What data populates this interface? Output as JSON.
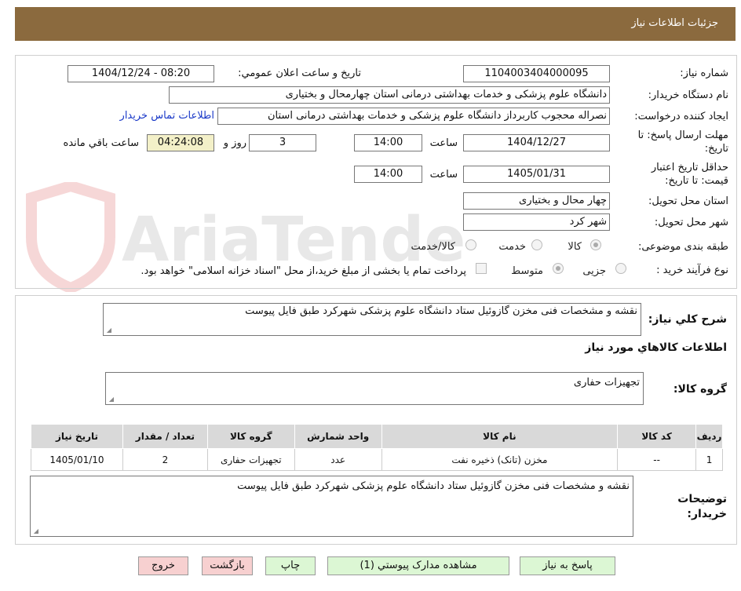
{
  "header": {
    "title": "جزئیات اطلاعات نیاز"
  },
  "watermark": {
    "text": "AriaTender.neT"
  },
  "form": {
    "need_number": {
      "label": "شماره نیاز:",
      "value": "1104003404000095"
    },
    "announce": {
      "label": "تاریخ و ساعت اعلان عمومي:",
      "value": "1404/12/24 - 08:20"
    },
    "buyer_org": {
      "label": "نام دستگاه خریدار:",
      "value": "دانشگاه علوم پزشکی و خدمات بهداشتی درمانی استان چهارمحال و بختیاری"
    },
    "requester": {
      "label": "ایجاد کننده درخواست:",
      "value": "نصراله محجوب کاربرداز دانشگاه علوم پزشکی و خدمات بهداشتی درمانی استان",
      "contact_link": "اطلاعات تماس خریدار"
    },
    "reply_deadline": {
      "label_line1": "مهلت ارسال پاسخ: تا",
      "label_line2": "تاریخ:",
      "date": "1404/12/27",
      "time_label": "ساعت",
      "time": "14:00",
      "days": "3",
      "days_label": "روز و",
      "remaining": "04:24:08",
      "remaining_label": "ساعت باقي مانده"
    },
    "price_validity": {
      "label_line1": "حداقل تاریخ اعتبار",
      "label_line2": "قیمت: تا تاریخ:",
      "date": "1405/01/31",
      "time_label": "ساعت",
      "time": "14:00"
    },
    "province": {
      "label": "استان محل تحویل:",
      "value": "چهار محال و بختیاری"
    },
    "city": {
      "label": "شهر محل تحویل:",
      "value": "شهر کرد"
    },
    "category": {
      "label": "طبقه بندی موضوعی:",
      "options": [
        "کالا",
        "خدمت",
        "کالا/خدمت"
      ],
      "selected": "کالا"
    },
    "process": {
      "label": "نوع فرآیند خرید :",
      "options": [
        "جزیی",
        "متوسط"
      ],
      "selected": "متوسط",
      "payment_note": "پرداخت تمام یا بخشی از مبلغ خرید،از محل \"اسناد خزانه اسلامی\" خواهد بود."
    }
  },
  "summary": {
    "label": "شرح كلي نياز:",
    "value": "نقشه و مشخصات فنی مخزن گازوئیل ستاد دانشگاه علوم پزشکی شهرکرد طبق فایل پیوست"
  },
  "goods_title": "اطلاعات کالاهاي مورد نياز",
  "goods_group": {
    "label": "گروه کالا:",
    "value": "تجهیزات حفاری"
  },
  "table": {
    "headers": [
      "ردیف",
      "کد کالا",
      "نام کالا",
      "واحد شمارش",
      "گروه کالا",
      "تعداد / مقدار",
      "تاریخ نیاز"
    ],
    "rows": [
      [
        "1",
        "--",
        "مخزن (تانک) ذخیره نفت",
        "عدد",
        "تجهیزات حفاری",
        "2",
        "1405/01/10"
      ]
    ]
  },
  "buyer_notes": {
    "label_line1": "توضیحات",
    "label_line2": "خریدار:",
    "value": "نقشه و مشخصات فنی مخزن گازوئیل ستاد دانشگاه علوم پزشکی شهرکرد طبق فایل پیوست"
  },
  "buttons": {
    "reply": "پاسخ به نیاز",
    "docs": "مشاهده مدارک پیوستي (1)",
    "print": "چاپ",
    "back": "بازگشت",
    "exit": "خروج"
  },
  "colors": {
    "header_bg": "#8b6a3e",
    "remaining_bg": "#f3f0c8",
    "button_green": "#dcf7d4",
    "button_pink": "#f7d0d0",
    "link": "#1a39c8"
  }
}
